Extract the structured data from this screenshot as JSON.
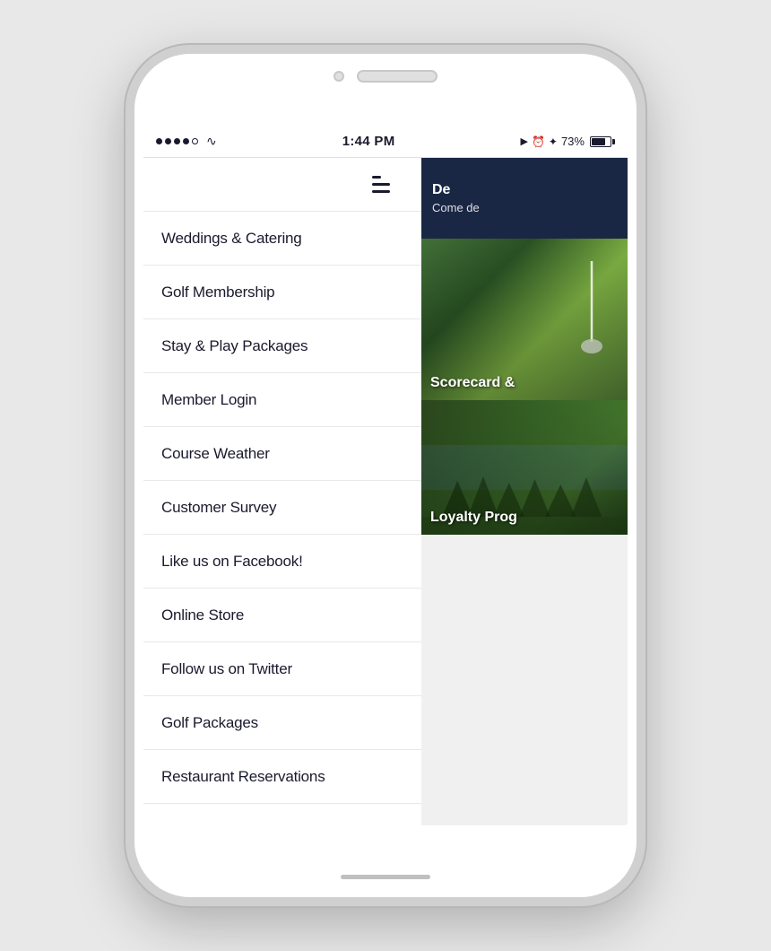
{
  "phone": {
    "status_bar": {
      "time": "1:44 PM",
      "battery_percent": "73%"
    },
    "menu": {
      "items": [
        {
          "id": "weddings",
          "label": "Weddings & Catering"
        },
        {
          "id": "golf-membership",
          "label": "Golf Membership"
        },
        {
          "id": "stay-play",
          "label": "Stay & Play Packages"
        },
        {
          "id": "member-login",
          "label": "Member Login"
        },
        {
          "id": "course-weather",
          "label": "Course Weather"
        },
        {
          "id": "customer-survey",
          "label": "Customer Survey"
        },
        {
          "id": "facebook",
          "label": "Like us on Facebook!"
        },
        {
          "id": "online-store",
          "label": "Online Store"
        },
        {
          "id": "twitter",
          "label": "Follow us on Twitter"
        },
        {
          "id": "golf-packages",
          "label": "Golf Packages"
        },
        {
          "id": "restaurant",
          "label": "Restaurant Reservations"
        }
      ]
    },
    "content": {
      "right_top_title": "De",
      "right_top_sub": "Come de",
      "scorecard_label": "Scorecard &",
      "loyalty_label": "Loyalty Prog"
    }
  }
}
